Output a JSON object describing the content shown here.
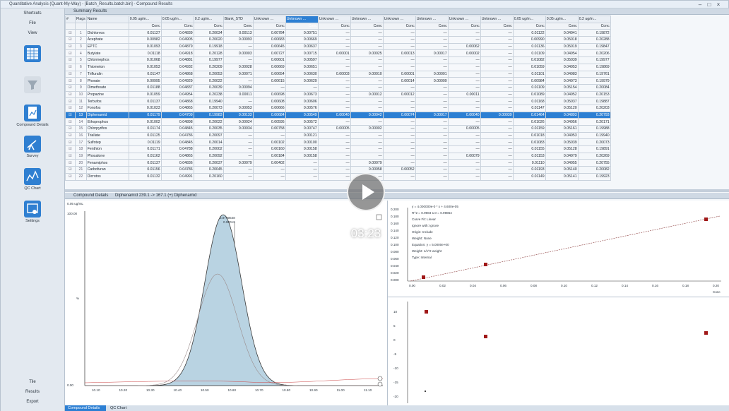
{
  "window": {
    "title": "Quantitative Analysis (Quant-My-Way) - [Batch_Results.batch.bin] - Compound Results"
  },
  "sidebar": {
    "header": "Shortcuts",
    "menu": [
      "File",
      "View"
    ],
    "items": [
      {
        "label": "",
        "icon": "table-icon"
      },
      {
        "label": "",
        "icon": "filter-icon"
      },
      {
        "label": "Compound Details",
        "icon": "document-chart-icon"
      },
      {
        "label": "Survey",
        "icon": "telescope-icon"
      },
      {
        "label": "QC Chart",
        "icon": "qc-chart-icon"
      },
      {
        "label": "Settings",
        "icon": "settings-window-icon"
      }
    ],
    "footer": [
      "Tile",
      "Results",
      "Export"
    ]
  },
  "summary": {
    "title": "Summary Results",
    "columns": [
      {
        "name": "Flags"
      },
      {
        "name": "Name"
      },
      {
        "name": "0.05 ug/m...",
        "sub": "Conc"
      },
      {
        "name": "0.05 ug/m...",
        "sub": "Conc"
      },
      {
        "name": "0.2 ug/m...",
        "sub": "Conc"
      },
      {
        "name": "Blank_STD",
        "sub": "Conc"
      },
      {
        "name": "Unknown ...",
        "sub": "Conc"
      },
      {
        "name": "Unknown ...",
        "sub": "Conc"
      },
      {
        "name": "Unknown ...",
        "sub": "Conc"
      },
      {
        "name": "Unknown ...",
        "sub": "Conc"
      },
      {
        "name": "Unknown ...",
        "sub": "Conc"
      },
      {
        "name": "Unknown ...",
        "sub": "Conc"
      },
      {
        "name": "Unknown ...",
        "sub": "Conc"
      },
      {
        "name": "Unknown ...",
        "sub": "Conc"
      },
      {
        "name": "0.05 ug/m...",
        "sub": "Conc"
      },
      {
        "name": "0.05 ug/m...",
        "sub": "Conc"
      },
      {
        "name": "0.2 ug/m...",
        "sub": "Conc"
      }
    ],
    "rows": [
      {
        "n": "1",
        "name": "Dichlorvos",
        "v": [
          "0.01127",
          "0.04839",
          "0.20034",
          "0.00113",
          "0.00784",
          "0.00751",
          "—",
          "—",
          "—",
          "—",
          "—",
          "—",
          "0.01122",
          "0.04941",
          "0.19872"
        ]
      },
      {
        "n": "2",
        "name": "Acephate",
        "v": [
          "0.00982",
          "0.04905",
          "0.20020",
          "0.00093",
          "0.00683",
          "0.00669",
          "—",
          "—",
          "—",
          "—",
          "—",
          "—",
          "0.00990",
          "0.05018",
          "0.20288"
        ]
      },
      {
        "n": "3",
        "name": "EPTC",
        "v": [
          "0.01093",
          "0.04879",
          "0.19918",
          "—",
          "0.00645",
          "0.00637",
          "—",
          "—",
          "—",
          "—",
          "0.00062",
          "—",
          "0.01136",
          "0.05019",
          "0.19847"
        ]
      },
      {
        "n": "4",
        "name": "Butylate",
        "v": [
          "0.01118",
          "0.04918",
          "0.20128",
          "0.00003",
          "0.00727",
          "0.00715",
          "0.00001",
          "0.00025",
          "0.00013",
          "0.00017",
          "0.00002",
          "—",
          "0.01109",
          "0.04954",
          "0.20206"
        ]
      },
      {
        "n": "5",
        "name": "Chlormephos",
        "v": [
          "0.01068",
          "0.04881",
          "0.19977",
          "—",
          "0.00601",
          "0.00597",
          "—",
          "—",
          "—",
          "—",
          "—",
          "—",
          "0.01082",
          "0.05039",
          "0.19977"
        ]
      },
      {
        "n": "6",
        "name": "Thiometon",
        "v": [
          "0.01053",
          "0.04932",
          "0.20209",
          "0.00028",
          "0.00669",
          "0.00651",
          "—",
          "—",
          "—",
          "—",
          "—",
          "—",
          "0.01059",
          "0.04953",
          "0.19869"
        ]
      },
      {
        "n": "7",
        "name": "Trifluralin",
        "v": [
          "0.01147",
          "0.04868",
          "0.20053",
          "0.00071",
          "0.00654",
          "0.00630",
          "0.00003",
          "0.00010",
          "0.00001",
          "0.00001",
          "—",
          "—",
          "0.01101",
          "0.04983",
          "0.19761"
        ]
      },
      {
        "n": "8",
        "name": "Phorate",
        "v": [
          "0.00995",
          "0.04929",
          "0.20022",
          "—",
          "0.00615",
          "0.00629",
          "—",
          "—",
          "0.00014",
          "0.00009",
          "—",
          "—",
          "0.00984",
          "0.04973",
          "0.19979"
        ]
      },
      {
        "n": "9",
        "name": "Dimethoate",
        "v": [
          "0.01188",
          "0.04837",
          "0.20039",
          "0.00094",
          "—",
          "—",
          "—",
          "—",
          "—",
          "—",
          "—",
          "—",
          "0.01109",
          "0.05154",
          "0.20084"
        ]
      },
      {
        "n": "10",
        "name": "Propazine",
        "v": [
          "0.01059",
          "0.04954",
          "0.20238",
          "0.00011",
          "0.00698",
          "0.00673",
          "—",
          "0.00012",
          "0.00012",
          "—",
          "0.00011",
          "—",
          "0.01089",
          "0.04952",
          "0.20153"
        ]
      },
      {
        "n": "11",
        "name": "Terbufos",
        "v": [
          "0.01137",
          "0.04868",
          "0.19940",
          "—",
          "0.00608",
          "0.00606",
          "—",
          "—",
          "—",
          "—",
          "—",
          "—",
          "0.01168",
          "0.05037",
          "0.19887"
        ]
      },
      {
        "n": "12",
        "name": "Fonofos",
        "v": [
          "0.01023",
          "0.04865",
          "0.20073",
          "0.00053",
          "0.00666",
          "0.00576",
          "—",
          "—",
          "—",
          "—",
          "—",
          "—",
          "0.01147",
          "0.05120",
          "0.20203"
        ]
      },
      {
        "n": "13",
        "name": "Diphenamid",
        "v": [
          "0.01179",
          "0.04709",
          "0.19983",
          "0.00133",
          "0.00684",
          "0.00549",
          "0.00040",
          "0.00042",
          "0.00074",
          "0.00017",
          "0.00040",
          "0.00039",
          "0.01464",
          "0.04893",
          "0.20793"
        ]
      },
      {
        "n": "14",
        "name": "Ethoprophos",
        "v": [
          "0.01002",
          "0.04898",
          "0.20022",
          "0.00024",
          "0.00595",
          "0.00572",
          "—",
          "—",
          "—",
          "—",
          "—",
          "—",
          "0.01026",
          "0.04956",
          "0.20171"
        ]
      },
      {
        "n": "15",
        "name": "Chlorpyrifos",
        "v": [
          "0.01174",
          "0.04845",
          "0.20035",
          "0.00034",
          "0.00758",
          "0.00747",
          "0.00005",
          "0.00002",
          "—",
          "—",
          "0.00005",
          "—",
          "0.01159",
          "0.05161",
          "0.19988"
        ]
      },
      {
        "n": "16",
        "name": "Triallate",
        "v": [
          "0.01125",
          "0.04786",
          "0.20097",
          "—",
          "—",
          "0.00121",
          "—",
          "—",
          "—",
          "—",
          "—",
          "—",
          "0.01018",
          "0.04953",
          "0.19940"
        ]
      },
      {
        "n": "17",
        "name": "Sulfotep",
        "v": [
          "0.01119",
          "0.04845",
          "0.20014",
          "—",
          "0.00102",
          "0.00100",
          "—",
          "—",
          "—",
          "—",
          "—",
          "—",
          "0.01083",
          "0.05039",
          "0.20073"
        ]
      },
      {
        "n": "18",
        "name": "Fenthion",
        "v": [
          "0.01171",
          "0.04788",
          "0.20002",
          "—",
          "0.00160",
          "0.00158",
          "—",
          "—",
          "—",
          "—",
          "—",
          "—",
          "0.01155",
          "0.05128",
          "0.19891"
        ]
      },
      {
        "n": "19",
        "name": "Phosalone",
        "v": [
          "0.01162",
          "0.04865",
          "0.20092",
          "—",
          "0.00184",
          "0.00158",
          "—",
          "—",
          "—",
          "—",
          "0.00079",
          "—",
          "0.01153",
          "0.04979",
          "0.20269"
        ]
      },
      {
        "n": "20",
        "name": "Fenamiphos",
        "v": [
          "0.01137",
          "0.04836",
          "0.20037",
          "0.00079",
          "0.00402",
          "—",
          "—",
          "0.00079",
          "—",
          "—",
          "—",
          "—",
          "0.01110",
          "0.04955",
          "0.20755"
        ]
      },
      {
        "n": "21",
        "name": "Carbofuran",
        "v": [
          "0.01156",
          "0.04786",
          "0.20045",
          "—",
          "—",
          "—",
          "—",
          "0.00058",
          "0.00052",
          "—",
          "—",
          "—",
          "0.01193",
          "0.05140",
          "0.20082"
        ]
      },
      {
        "n": "22",
        "name": "Dicrotos",
        "v": [
          "0.01132",
          "0.04991",
          "0.20160",
          "—",
          "—",
          "—",
          "—",
          "—",
          "—",
          "—",
          "—",
          "—",
          "0.01149",
          "0.05141",
          "0.19923"
        ]
      }
    ],
    "selected_row": 13
  },
  "details": {
    "title": "Compound Details",
    "info": "Diphenamid   239.1 -> 167.1 (+)   Diphenamid",
    "chromatogram": {
      "y_max_label": "100.00",
      "y_zero_label": "0.00",
      "y_label": "%",
      "corner": "0.05 ug/mL",
      "peak_label_top": "5.8+00548",
      "peak_label_mid": "0.00013",
      "x_ticks": [
        "10.10",
        "10.20",
        "10.30",
        "10.40",
        "10.50",
        "10.60",
        "10.70",
        "10.80",
        "10.90",
        "11.00",
        "11.10"
      ]
    },
    "calibration": {
      "legend_lines": [
        "y = 4.000000e-0 * x + 4.600e-05",
        "R^2 = 0.9984   1.0 = 0.99854",
        "Curve Fit: Linear",
        "Ignore with: Ignore",
        "Origin: Include",
        "Weight: None",
        "Equation: y = 5.0000e+00",
        "Weight: 1/x^2 weight",
        "Type: Internal"
      ],
      "y_ticks": [
        "0.200",
        "0.180",
        "0.160",
        "0.140",
        "0.120",
        "0.100",
        "0.080",
        "0.060",
        "0.040",
        "0.020",
        "0.000"
      ],
      "x_ticks": [
        "0.00",
        "0.02",
        "0.04",
        "0.06",
        "0.08",
        "0.10",
        "0.12",
        "0.14",
        "0.16",
        "0.18",
        "0.20"
      ],
      "x_label": "Conc"
    },
    "residuals": {
      "y_ticks": [
        "10",
        "5",
        "0",
        "-5",
        "-10",
        "-15",
        "-20"
      ]
    }
  },
  "bottom_tabs": [
    "Compound Details",
    "QC Chart"
  ],
  "video": {
    "timestamp": "03:23"
  }
}
